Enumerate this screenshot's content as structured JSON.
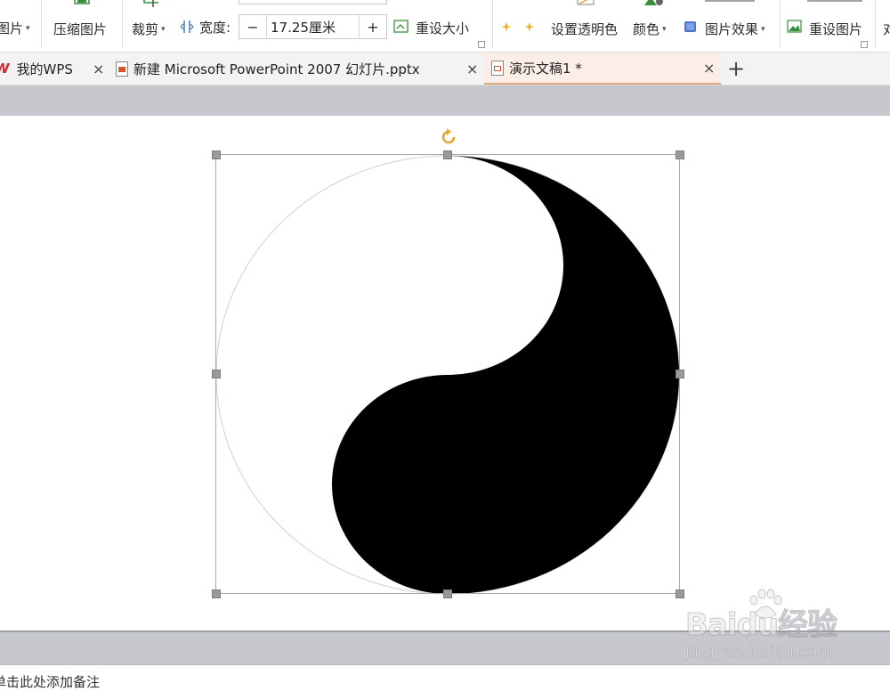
{
  "ribbon": {
    "picture_partial_label": "图片",
    "compress_label": "压缩图片",
    "crop_label": "裁剪",
    "width_label": "宽度:",
    "width_value": "17.25厘米",
    "stepper_minus": "−",
    "stepper_plus": "+",
    "reset_size_label": "重设大小",
    "set_transparent_label": "设置透明色",
    "color_label": "颜色",
    "picture_effects_label": "图片效果",
    "reset_picture_label": "重设图片",
    "partial_right_label": "对"
  },
  "tabs": [
    {
      "label": "我的WPS",
      "logo": "W"
    },
    {
      "label": "新建 Microsoft PowerPoint 2007 幻灯片.pptx"
    },
    {
      "label": "演示文稿1 *"
    }
  ],
  "notes": {
    "placeholder": "单击此处添加备注"
  },
  "watermark": {
    "brand": "Baidu经验",
    "url": "jingyan.baidu.com"
  },
  "colors": {
    "active_tab_bg": "#fbeee6",
    "rotate_handle": "#e8a33a",
    "workspace_gray": "#c7c8ce",
    "logo_red": "#d0262d"
  }
}
